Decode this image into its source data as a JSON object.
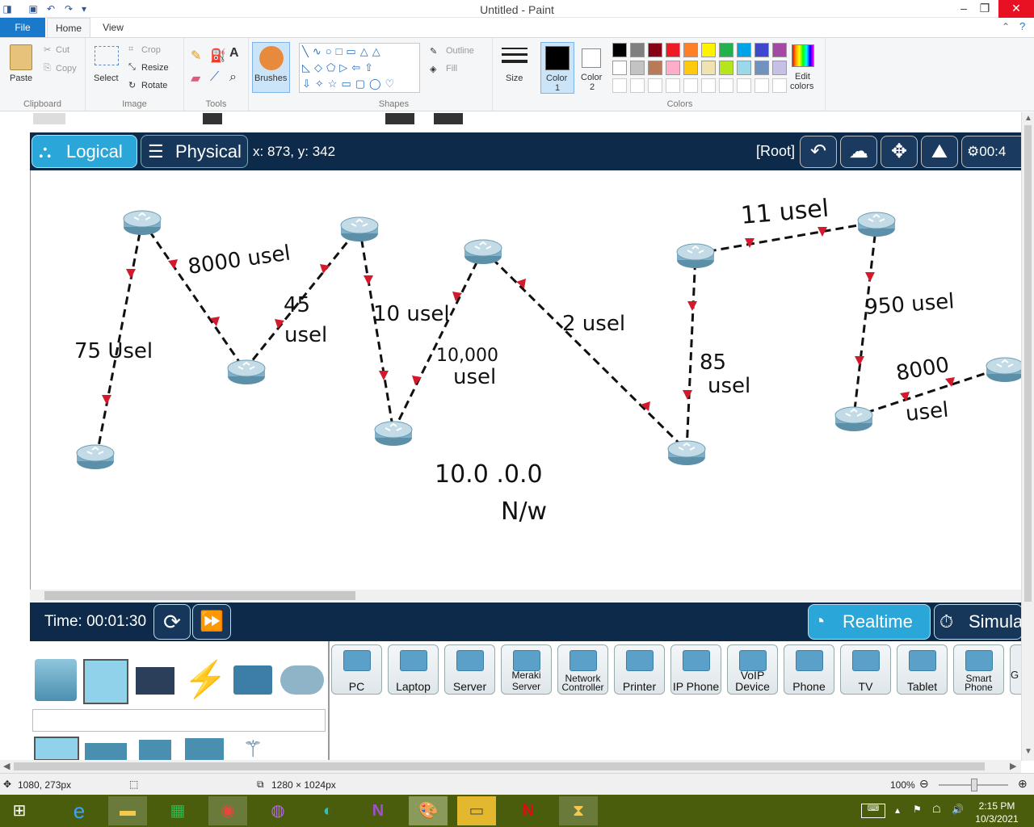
{
  "window": {
    "title": "Untitled - Paint"
  },
  "tabs": {
    "file": "File",
    "home": "Home",
    "view": "View"
  },
  "ribbon": {
    "clipboard": {
      "label": "Clipboard",
      "paste": "Paste",
      "cut": "Cut",
      "copy": "Copy"
    },
    "image": {
      "label": "Image",
      "select": "Select",
      "crop": "Crop",
      "resize": "Resize",
      "rotate": "Rotate"
    },
    "tools": {
      "label": "Tools"
    },
    "brushes": {
      "label": "Brushes"
    },
    "shapes": {
      "label": "Shapes",
      "outline": "Outline",
      "fill": "Fill"
    },
    "size": {
      "label": "Size"
    },
    "colors": {
      "label": "Colors",
      "color1": "Color 1",
      "color1_a": "Color",
      "color1_b": "1",
      "color2_a": "Color",
      "color2_b": "2",
      "edit_a": "Edit",
      "edit_b": "colors",
      "palette": [
        "#000000",
        "#7f7f7f",
        "#880015",
        "#ed1c24",
        "#ff7f27",
        "#fff200",
        "#22b14c",
        "#00a2e8",
        "#3f48cc",
        "#a349a4",
        "#ffffff",
        "#c3c3c3",
        "#b97a57",
        "#ffaec9",
        "#ffc90e",
        "#efe4b0",
        "#b5e61d",
        "#99d9ea",
        "#7092be",
        "#c8bfe7"
      ]
    }
  },
  "pt": {
    "logical": "Logical",
    "physical": "Physical",
    "coords": "x: 873, y: 342",
    "root": "[Root]",
    "clock_partial": "00:4",
    "time": "Time: 00:01:30",
    "realtime": "Realtime",
    "simulation_partial": "Simula",
    "devices": [
      "PC",
      "Laptop",
      "Server",
      "Meraki Server",
      "Network Controller",
      "Printer",
      "IP Phone",
      "VoIP Device",
      "Phone",
      "TV",
      "Tablet",
      "Smart Phone"
    ],
    "devices_multi": {
      "network_a": "Network",
      "network_b": "Controller",
      "voip_a": "VoIP",
      "voip_b": "Device",
      "smart_a": "Smart",
      "smart_b": "Phone"
    },
    "last_partial": "G"
  },
  "annotations": {
    "a1": "75 Usel",
    "a2": "8000 usel",
    "a3a": "45",
    "a3b": "usel",
    "a4": "10 usel",
    "a5a": "10,000",
    "a5b": "usel",
    "a6": "2 usel",
    "a7a": "85",
    "a7b": "usel",
    "a8": "11 usel",
    "a9": "950 usel",
    "a10a": "8000",
    "a10b": "usel",
    "net1": "10.0 .0.0",
    "net2": "N/w"
  },
  "status": {
    "cursor": "1080, 273px",
    "size": "1280 × 1024px",
    "zoom": "100%"
  },
  "taskbar": {
    "time": "2:15 PM",
    "date": "10/3/2021"
  }
}
